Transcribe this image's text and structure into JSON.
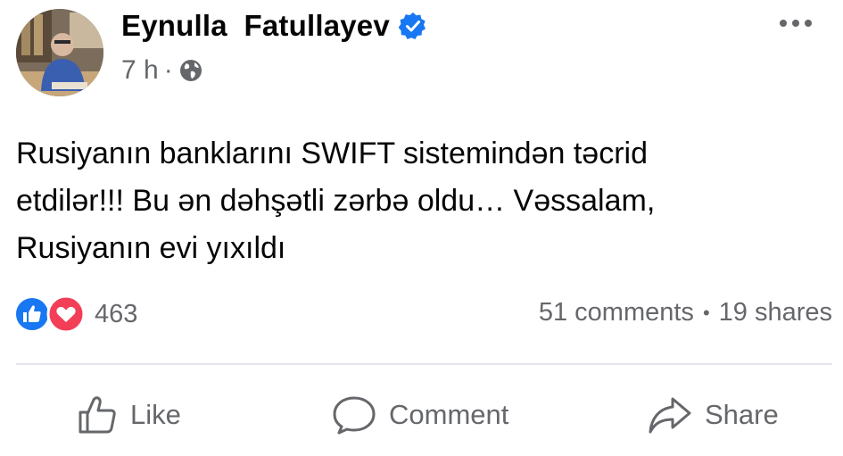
{
  "post": {
    "author": "Eynulla  Fatullayev",
    "time": "7 h",
    "separator": "·",
    "text_lines": [
      "Rusiyanın banklarını SWIFT sistemindən təcrid",
      "etdilər!!! Bu ən dəhşətli zərbə oldu… Vəssalam,",
      "Rusiyanın evi yıxıldı"
    ]
  },
  "reactions": {
    "count": "463"
  },
  "stats": {
    "comments": "51 comments",
    "dot": "•",
    "shares": "19 shares"
  },
  "actions": {
    "like": "Like",
    "comment": "Comment",
    "share": "Share"
  },
  "colors": {
    "verified": "#1877f2",
    "like": "#1877f2",
    "love": "#f33e58",
    "secondary_text": "#65676b",
    "divider": "#e4e6eb"
  },
  "icons": [
    "verified-badge-icon",
    "globe-icon",
    "more-options-icon",
    "like-reaction-icon",
    "love-reaction-icon",
    "thumbs-up-icon",
    "comment-bubble-icon",
    "share-arrow-icon"
  ]
}
